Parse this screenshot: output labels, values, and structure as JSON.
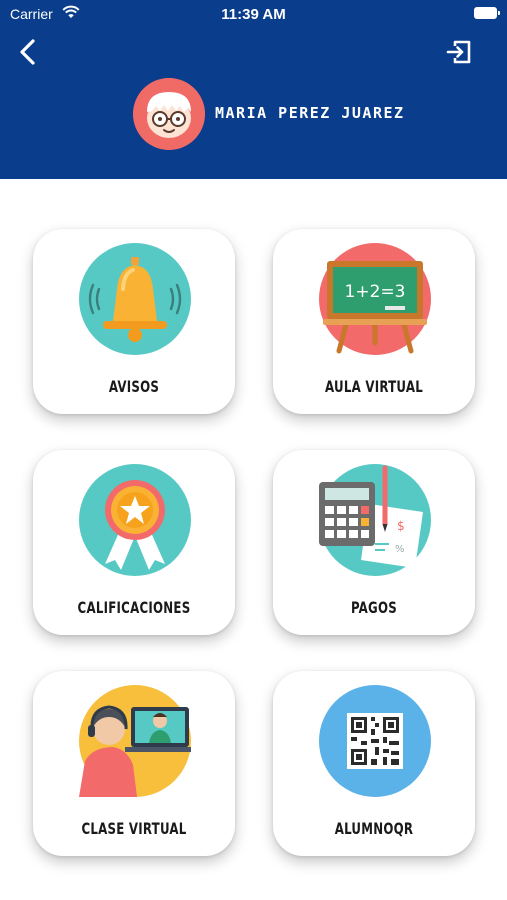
{
  "status_bar": {
    "carrier": "Carrier",
    "time": "11:39 AM"
  },
  "header": {
    "background": "#0a3d8c",
    "back_icon": "chevron-left-icon",
    "logout_icon": "logout-icon",
    "user_name": "MARIA PEREZ JUAREZ",
    "avatar_icon": "student-avatar-icon"
  },
  "menu": [
    {
      "label": "AVISOS",
      "icon": "bell-icon",
      "circle_color": "#57c9c4"
    },
    {
      "label": "AULA VIRTUAL",
      "icon": "chalkboard-icon",
      "circle_color": "#f26a6a"
    },
    {
      "label": "CALIFICACIONES",
      "icon": "award-ribbon-icon",
      "circle_color": "#57c9c4"
    },
    {
      "label": "PAGOS",
      "icon": "calculator-receipt-icon",
      "circle_color": "#57c9c4"
    },
    {
      "label": "CLASE VIRTUAL",
      "icon": "video-call-icon",
      "circle_color": "#f7bf3c"
    },
    {
      "label": "ALUMNOQR",
      "icon": "qr-code-icon",
      "circle_color": "#5ab2e8"
    }
  ]
}
